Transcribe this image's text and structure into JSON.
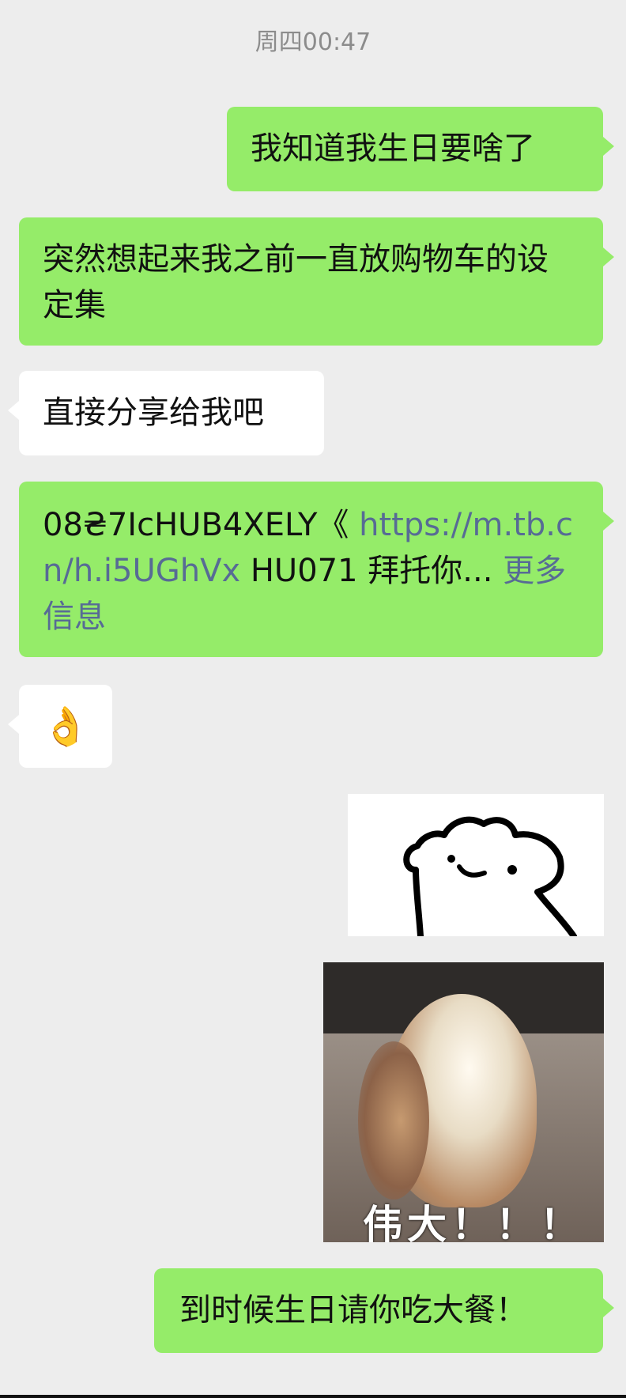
{
  "timestamp": "周四00:47",
  "messages": [
    {
      "side": "right",
      "text": "我知道我生日要啥了"
    },
    {
      "side": "right",
      "text": "突然想起来我之前一直放购物车的设定集"
    },
    {
      "side": "left",
      "text": "直接分享给我吧"
    },
    {
      "side": "right",
      "code": "08₴7IcHUB4XELY《",
      "url": "https://m.tb.cn/h.i5UGhVx",
      "code2": "HU071 拜托你...",
      "more": "更多信息"
    },
    {
      "side": "left",
      "emoji": "👌"
    },
    {
      "side": "right",
      "sticker": "cat-sticker"
    },
    {
      "side": "right",
      "sticker": "hamster-sticker",
      "caption": "伟大！！！"
    },
    {
      "side": "right",
      "text": "到时候生日请你吃大餐！"
    }
  ],
  "colors": {
    "background": "#ededed",
    "sent_bubble": "#95ec69",
    "received_bubble": "#ffffff",
    "link": "#576b95",
    "timestamp": "#8c8c8c"
  }
}
